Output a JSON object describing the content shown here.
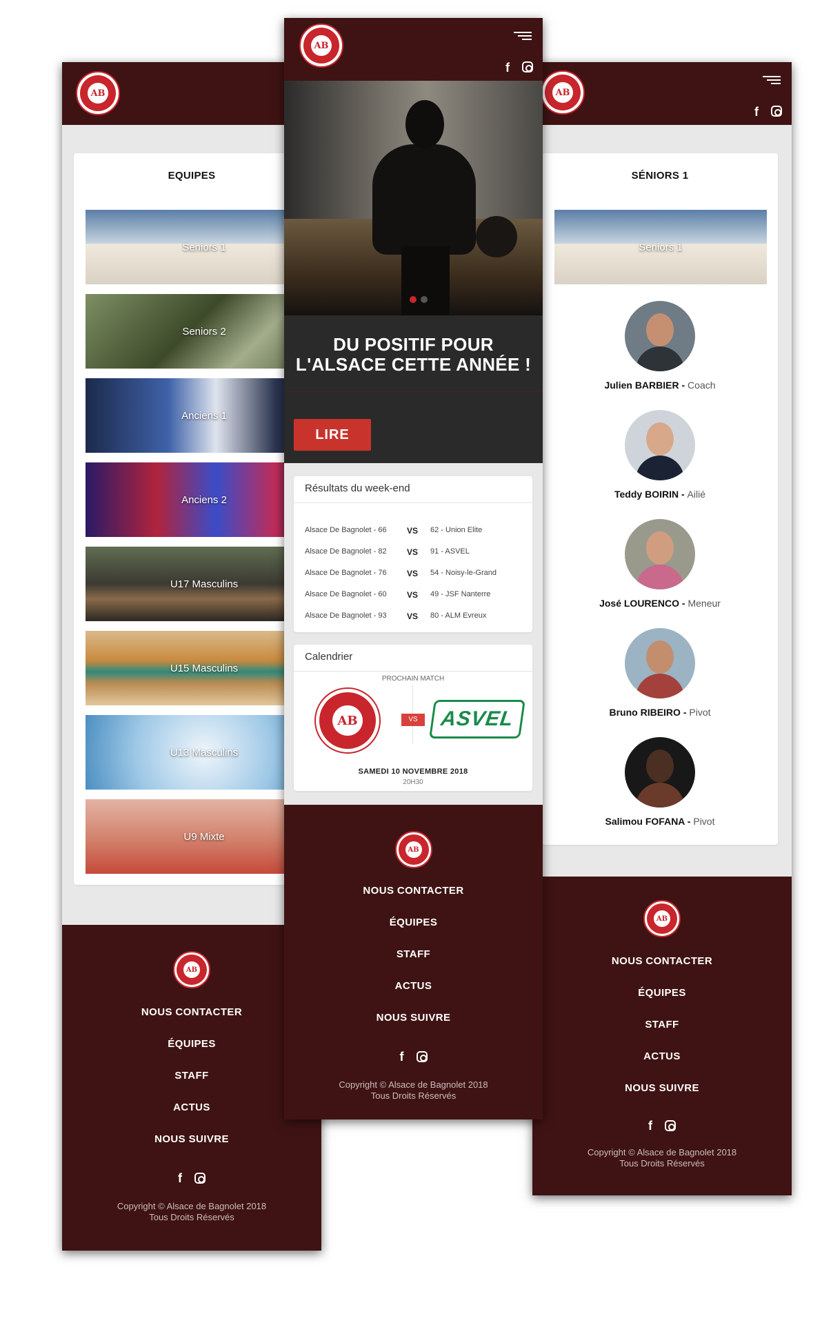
{
  "brand": {
    "logo_initials": "AB",
    "primary_color": "#c8262c",
    "maroon": "#3f1313"
  },
  "header": {
    "menu_icon": "hamburger-icon",
    "social": [
      "facebook-icon",
      "instagram-icon"
    ]
  },
  "left_screen": {
    "title": "EQUIPES",
    "teams": [
      {
        "label": "Seniors 1"
      },
      {
        "label": "Seniors 2"
      },
      {
        "label": "Anciens 1"
      },
      {
        "label": "Anciens 2"
      },
      {
        "label": "U17 Masculins"
      },
      {
        "label": "U15 Masculins"
      },
      {
        "label": "U13 Masculins"
      },
      {
        "label": "U9 Mixte"
      }
    ]
  },
  "center_screen": {
    "hero": {
      "slides": 2,
      "active_slide": 1
    },
    "news": {
      "title": "DU POSITIF POUR L'ALSACE CETTE ANNÉE !",
      "button": "LIRE"
    },
    "results": {
      "title": "Résultats du week-end",
      "vs_label": "VS",
      "rows": [
        {
          "home": "Alsace De Bagnolet - 66",
          "away": "62 - Union Elite"
        },
        {
          "home": "Alsace De Bagnolet - 82",
          "away": "91 - ASVEL"
        },
        {
          "home": "Alsace De Bagnolet - 76",
          "away": "54 - Noisy-le-Grand"
        },
        {
          "home": "Alsace De Bagnolet - 60",
          "away": "49 - JSF Nanterre"
        },
        {
          "home": "Alsace De Bagnolet - 93",
          "away": "80 - ALM Evreux"
        }
      ]
    },
    "calendar": {
      "title": "Calendrier",
      "next_label": "PROCHAIN MATCH",
      "vs_label": "VS",
      "opponent_logo_text": "ASVEL",
      "date": "SAMEDI 10 NOVEMBRE 2018",
      "time": "20H30"
    }
  },
  "right_screen": {
    "title": "SÉNIORS 1",
    "banner_label": "Seniors 1",
    "staff": [
      {
        "name": "Julien BARBIER",
        "sep": " - ",
        "role": "Coach"
      },
      {
        "name": "Teddy BOIRIN",
        "sep": " - ",
        "role": "Ailié"
      },
      {
        "name": "José LOURENCO",
        "sep": " - ",
        "role": "Meneur"
      },
      {
        "name": "Bruno RIBEIRO",
        "sep": " - ",
        "role": "Pivot"
      },
      {
        "name": "Salimou FOFANA",
        "sep": " - ",
        "role": "Pivot"
      }
    ]
  },
  "footer": {
    "nav": [
      "NOUS CONTACTER",
      "ÉQUIPES",
      "STAFF",
      "ACTUS",
      "NOUS SUIVRE"
    ],
    "copyright_line1": "Copyright © Alsace de Bagnolet 2018",
    "copyright_line2": "Tous Droits Réservés"
  }
}
